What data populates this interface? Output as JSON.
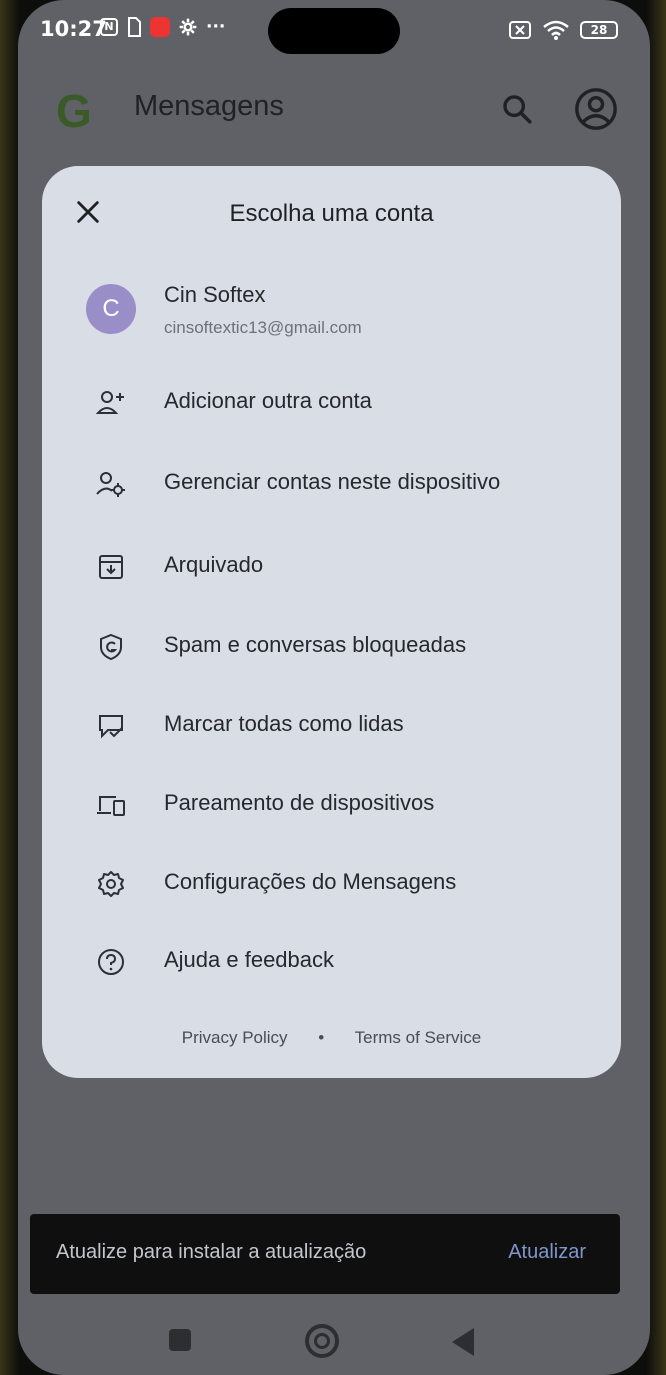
{
  "status_bar": {
    "time": "10:27",
    "battery": "28",
    "left_icons": [
      "nfc-icon",
      "sim-icon",
      "notification-app-icon",
      "settings-icon",
      "more-icon"
    ],
    "right_icons": [
      "sim-off-icon",
      "wifi-icon",
      "battery-icon"
    ],
    "more_glyph": "···"
  },
  "app_bar": {
    "logo": "G",
    "title": "Mensagens",
    "actions": [
      "search-icon",
      "account-circle-icon"
    ]
  },
  "account_sheet": {
    "title": "Escolha uma conta",
    "account": {
      "initial": "C",
      "name": "Cin Softex",
      "email": "cinsoftextic13@gmail.com",
      "avatar_color": "#9a8ec9"
    },
    "items": [
      {
        "label": "Adicionar outra conta",
        "icon": "add-person-icon"
      },
      {
        "label": "Gerenciar contas neste dispositivo",
        "icon": "manage-accounts-icon"
      },
      {
        "label": "Arquivado",
        "icon": "archive-icon"
      },
      {
        "label": "Spam e conversas bloqueadas",
        "icon": "spam-shield-icon"
      },
      {
        "label": "Marcar todas como lidas",
        "icon": "mark-read-icon"
      },
      {
        "label": "Pareamento de dispositivos",
        "icon": "devices-icon"
      },
      {
        "label": "Configurações do Mensagens",
        "icon": "gear-icon"
      },
      {
        "label": "Ajuda e feedback",
        "icon": "help-icon"
      }
    ],
    "footer": {
      "privacy": "Privacy Policy",
      "separator": "•",
      "terms": "Terms of Service"
    }
  },
  "snackbar": {
    "message": "Atualize para instalar a atualização",
    "action": "Atualizar"
  },
  "nav_bar": {
    "buttons": [
      "recents-button",
      "home-button",
      "back-button"
    ]
  },
  "colors": {
    "sheet_bg": "#d8dde6",
    "scrim": "#5f6166",
    "snackbar_bg": "#0f0f10",
    "snackbar_action": "#7f96c9"
  }
}
